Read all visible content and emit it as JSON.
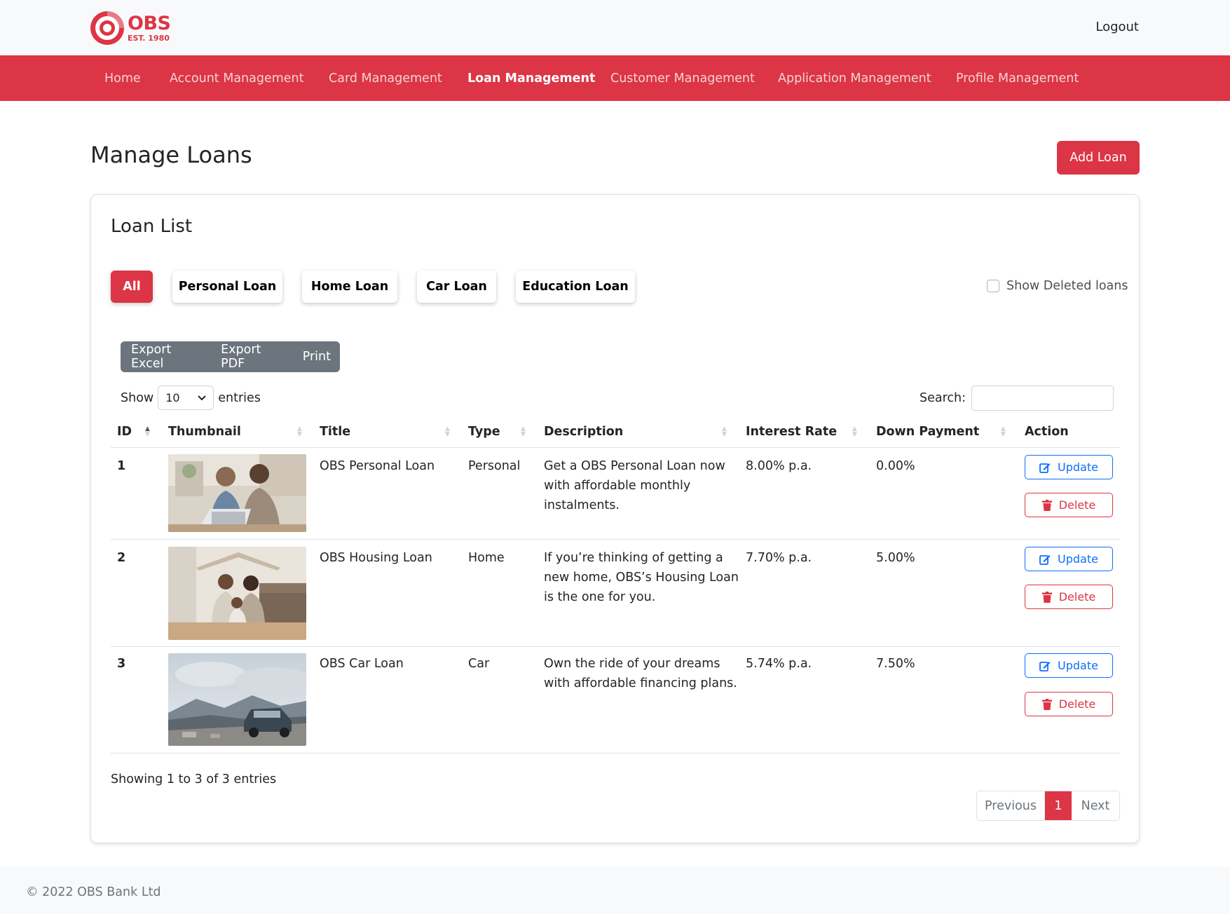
{
  "brand": {
    "name": "OBS",
    "established": "EST. 1980",
    "color": "#dc3545"
  },
  "topbar": {
    "logout_label": "Logout"
  },
  "nav": {
    "items": [
      {
        "label": "Home",
        "active": false
      },
      {
        "label": "Account Management",
        "active": false
      },
      {
        "label": "Card Management",
        "active": false
      },
      {
        "label": "Loan Management",
        "active": true
      },
      {
        "label": "Customer Management",
        "active": false
      },
      {
        "label": "Application Management",
        "active": false
      },
      {
        "label": "Profile Management",
        "active": false
      }
    ]
  },
  "page": {
    "title": "Manage Loans",
    "add_button_label": "Add Loan"
  },
  "card": {
    "title": "Loan List",
    "filters": [
      {
        "label": "All",
        "active": true
      },
      {
        "label": "Personal Loan",
        "active": false
      },
      {
        "label": "Home Loan",
        "active": false
      },
      {
        "label": "Car Loan",
        "active": false
      },
      {
        "label": "Education Loan",
        "active": false
      }
    ],
    "show_deleted_label": "Show Deleted loans",
    "show_deleted_checked": false
  },
  "table_controls": {
    "export_buttons": [
      "Export Excel",
      "Export PDF",
      "Print"
    ],
    "show_label": "Show",
    "page_size": "10",
    "entries_label": "entries",
    "search_label": "Search:",
    "search_value": ""
  },
  "table": {
    "columns": [
      "ID",
      "Thumbnail",
      "Title",
      "Type",
      "Description",
      "Interest Rate",
      "Down Payment",
      "Action"
    ],
    "sorted_column": "ID",
    "rows": [
      {
        "id": "1",
        "thumbnail": "couple-at-laptop",
        "title": "OBS Personal Loan",
        "type": "Personal",
        "description": [
          "Get a OBS Personal Loan now",
          "with affordable monthly",
          "instalments."
        ],
        "interest_rate": "8.00% p.a.",
        "down_payment": "0.00%"
      },
      {
        "id": "2",
        "thumbnail": "family-under-roof",
        "title": "OBS Housing Loan",
        "type": "Home",
        "description": [
          "If you’re thinking of getting a",
          "new home, OBS’s Housing Loan",
          "is the one for you."
        ],
        "interest_rate": "7.70% p.a.",
        "down_payment": "5.00%"
      },
      {
        "id": "3",
        "thumbnail": "car-on-mountain",
        "title": "OBS Car Loan",
        "type": "Car",
        "description": [
          "Own the ride of your dreams",
          "with affordable financing plans."
        ],
        "interest_rate": "5.74% p.a.",
        "down_payment": "7.50%"
      }
    ],
    "update_label": "Update",
    "delete_label": "Delete"
  },
  "pagination": {
    "info": "Showing 1 to 3 of 3 entries",
    "previous": "Previous",
    "current_page": "1",
    "next": "Next"
  },
  "footer": {
    "text": "© 2022 OBS Bank Ltd"
  }
}
